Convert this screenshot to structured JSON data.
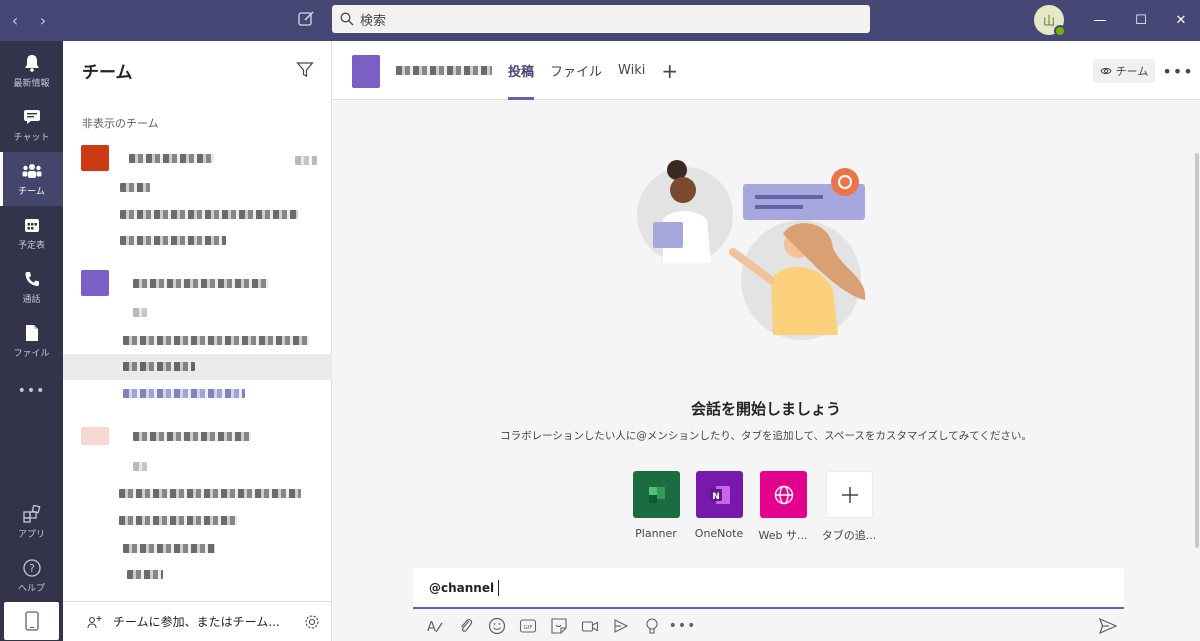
{
  "titlebar": {
    "back_glyph": "‹",
    "forward_glyph": "›",
    "search_placeholder": "検索",
    "avatar_initial": "山",
    "minimize": "—",
    "maximize": "☐",
    "close": "✕"
  },
  "rail": {
    "items": [
      {
        "label": "最新情報",
        "icon": "bell-icon"
      },
      {
        "label": "チャット",
        "icon": "chat-icon"
      },
      {
        "label": "チーム",
        "icon": "teams-icon"
      },
      {
        "label": "予定表",
        "icon": "calendar-icon"
      },
      {
        "label": "通話",
        "icon": "phone-icon"
      },
      {
        "label": "ファイル",
        "icon": "file-icon"
      },
      {
        "label": "•••",
        "icon": "more-icon"
      },
      {
        "label": "アプリ",
        "icon": "apps-icon"
      },
      {
        "label": "ヘルプ",
        "icon": "help-icon"
      }
    ]
  },
  "teampanel": {
    "title": "チーム",
    "section_label": "非表示のチーム",
    "footer_label": "チームに参加、またはチーム..."
  },
  "channel": {
    "tabs": [
      {
        "label": "投稿",
        "active": true
      },
      {
        "label": "ファイル",
        "active": false
      },
      {
        "label": "Wiki",
        "active": false
      }
    ],
    "add_tab": "+",
    "team_button": "チーム",
    "more": "•••"
  },
  "empty_state": {
    "title": "会話を開始しましょう",
    "subtitle": "コラボレーションしたい人に@メンションしたり、タブを追加して、スペースをカスタマイズしてみてください。",
    "apps": [
      {
        "label": "Planner",
        "color": "#1b6c40"
      },
      {
        "label": "OneNote",
        "color": "#7719aa"
      },
      {
        "label": "Web サ...",
        "color": "#e3008c"
      },
      {
        "label": "タブの追...",
        "color": "#ffffff"
      }
    ]
  },
  "compose": {
    "value": "@channel"
  },
  "colors": {
    "titlebar": "#464775",
    "rail": "#33344a",
    "accent": "#6264a7"
  }
}
